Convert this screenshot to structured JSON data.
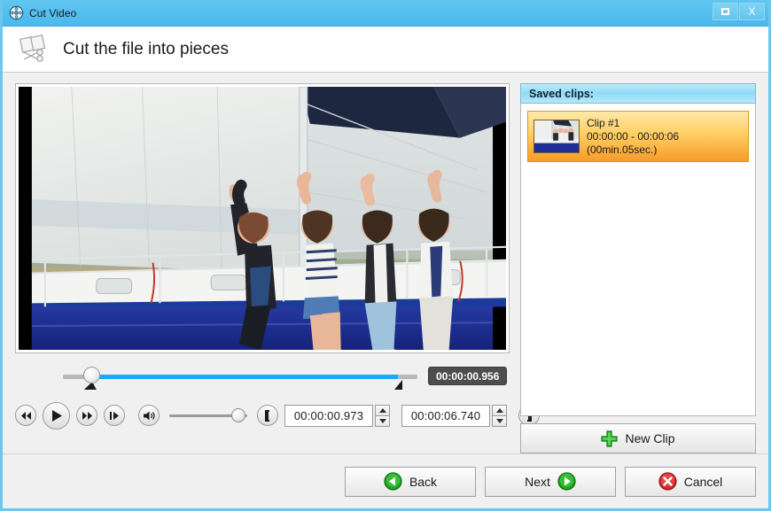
{
  "window": {
    "title": "Cut Video",
    "icon": "film-reel-icon",
    "maximize_label": "",
    "close_label": "X"
  },
  "header": {
    "title": "Cut the file into pieces",
    "icon": "film-scissors-icon"
  },
  "player": {
    "position_tooltip": "00:00:00.956",
    "buttons": {
      "rewind": "rewind-icon",
      "play": "play-icon",
      "forward": "forward-icon",
      "step": "step-frame-icon",
      "volume": "volume-icon",
      "mark_in": "[",
      "mark_out": "]"
    },
    "start_time": "00:00:00.973",
    "end_time": "00:00:06.740",
    "volume_level": 80
  },
  "clips_panel": {
    "header": "Saved clips:",
    "items": [
      {
        "name": "Clip #1",
        "range": "00:00:00 - 00:00:06",
        "duration": "(00min.05sec.)"
      }
    ],
    "new_clip_label": "New Clip"
  },
  "footer": {
    "back_label": "Back",
    "next_label": "Next",
    "cancel_label": "Cancel"
  },
  "colors": {
    "titlebar": "#55c0ee",
    "accent_blue": "#1eaaf1",
    "clip_orange": "#f79b2a",
    "green": "#1f9e1f",
    "red": "#d62828"
  }
}
